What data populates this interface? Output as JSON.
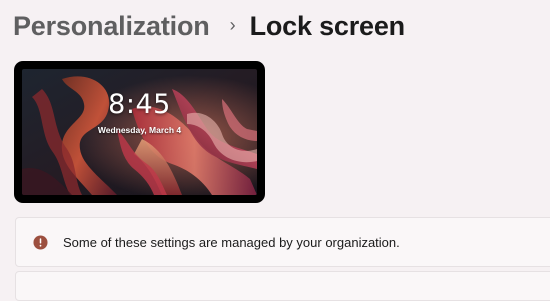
{
  "breadcrumb": {
    "parent": "Personalization",
    "separator": "›",
    "current": "Lock screen"
  },
  "preview": {
    "time": "8:45",
    "date": "Wednesday, March 4",
    "wallpaper": "abstract-ribbons-wallpaper"
  },
  "notice": {
    "icon": "info-icon",
    "text": "Some of these settings are managed by your organization.",
    "icon_color": "#9c4f3f"
  },
  "colors": {
    "background": "#f6f1f3",
    "card": "#faf7f8"
  }
}
